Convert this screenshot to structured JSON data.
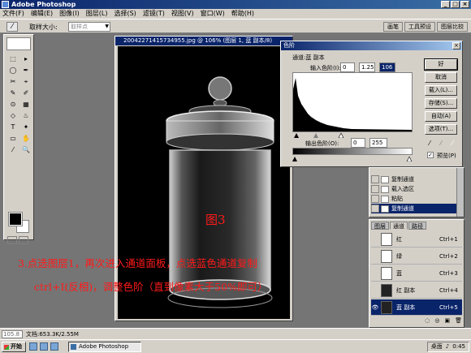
{
  "app": {
    "title": "Adobe Photoshop",
    "minimize": "_",
    "maximize": "□",
    "close": "×"
  },
  "menu": [
    "文件(F)",
    "编辑(E)",
    "图像(I)",
    "图层(L)",
    "选择(S)",
    "滤镜(T)",
    "视图(V)",
    "窗口(W)",
    "帮助(H)"
  ],
  "options_bar": {
    "tool_glyph": "⁄",
    "sample_label": "取样大小:",
    "sample_value": "取样点"
  },
  "palette_well_tabs": [
    "画笔",
    "工具预设",
    "图层比较"
  ],
  "toolbox": {
    "tool_glyphs": [
      "⬚",
      "▸",
      "◯",
      "✒",
      "✂",
      "⌖",
      "✎",
      "✐",
      "⊙",
      "▦",
      "◇",
      "♨",
      "T",
      "✦",
      "▭",
      "✋",
      "⁄",
      "🔍"
    ],
    "fg_color": "#000000",
    "bg_color": "#ffffff"
  },
  "document": {
    "title": "20042271415734955.jpg @ 106% (图层 1, 蓝 副本/8)"
  },
  "levels_dialog": {
    "title": "色阶",
    "channel_label": "通道:蓝 副本",
    "input_label": "输入色阶(I):",
    "input_values": [
      "0",
      "1.25",
      "106"
    ],
    "output_label": "输出色阶(O):",
    "output_values": [
      "0",
      "255"
    ],
    "buttons": [
      "好",
      "取消",
      "载入(L)...",
      "存储(S)...",
      "自动(A)",
      "选项(T)..."
    ],
    "preview_label": "预览(P)",
    "preview_checked": "✓",
    "close": "×"
  },
  "history_panel": {
    "items": [
      "复制通道",
      "载入选区",
      "粘贴",
      "复制通道"
    ],
    "active_index": 3
  },
  "channels_panel": {
    "tabs": [
      "图层",
      "通道",
      "路径"
    ],
    "rows": [
      {
        "eye": "",
        "name": "红",
        "key": "Ctrl+1"
      },
      {
        "eye": "",
        "name": "绿",
        "key": "Ctrl+2"
      },
      {
        "eye": "",
        "name": "蓝",
        "key": "Ctrl+3"
      },
      {
        "eye": "",
        "name": "红 副本",
        "key": "Ctrl+4"
      },
      {
        "eye": "👁",
        "name": "蓝 副本",
        "key": "Ctrl+5"
      }
    ],
    "active_index": 4,
    "footer_glyphs": [
      "◌",
      "◎",
      "▣",
      "🗑"
    ]
  },
  "status_bar": {
    "zoom": "105.8",
    "doc_size": "文档:653.3K/2.55M"
  },
  "taskbar": {
    "start": "开始",
    "task": "Adobe Photoshop",
    "tray_label": "桌面",
    "tray_time": "0:45"
  },
  "annotations": {
    "figure_label": "图3",
    "step_line1": "3.点选图层1，再次进入通道面板，点选蓝色通道复制",
    "step_line2": "ctrl+I(反相)，调整色阶（直到像素大于50%即可）",
    "color": "#ff1a1a"
  }
}
